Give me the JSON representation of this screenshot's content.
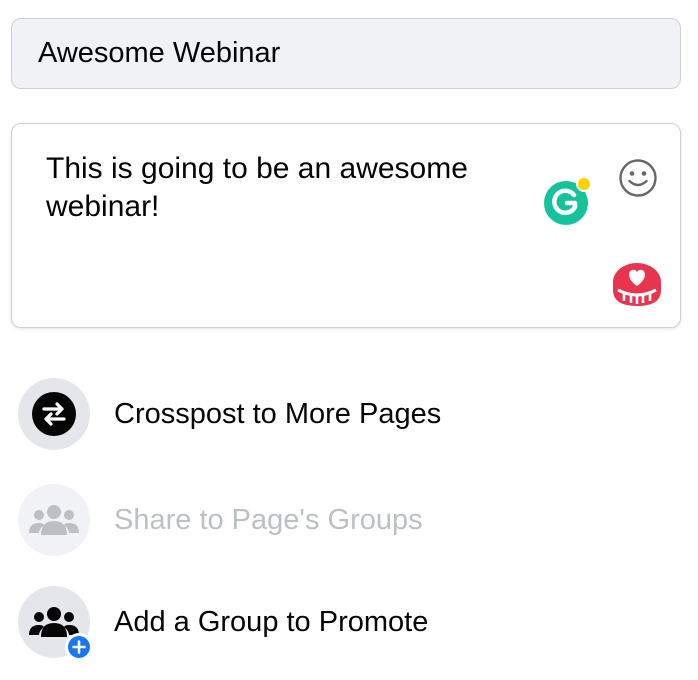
{
  "event": {
    "title_value": "Awesome Webinar",
    "description_value": "This is going to be an awesome webinar!"
  },
  "extensions": {
    "grammarly_icon": "grammarly-icon",
    "emoji_icon": "smiley-icon",
    "heart_icon": "heart-badge-icon"
  },
  "options": {
    "crosspost_label": "Crosspost to More Pages",
    "share_groups_label": "Share to Page's Groups",
    "add_group_label": "Add a Group to Promote"
  },
  "colors": {
    "grammarly_green": "#15c39a",
    "grammarly_dot": "#ffd100",
    "heart_red": "#e8344e",
    "plus_blue": "#1877f2",
    "disabled_text": "#bcc0c4"
  }
}
